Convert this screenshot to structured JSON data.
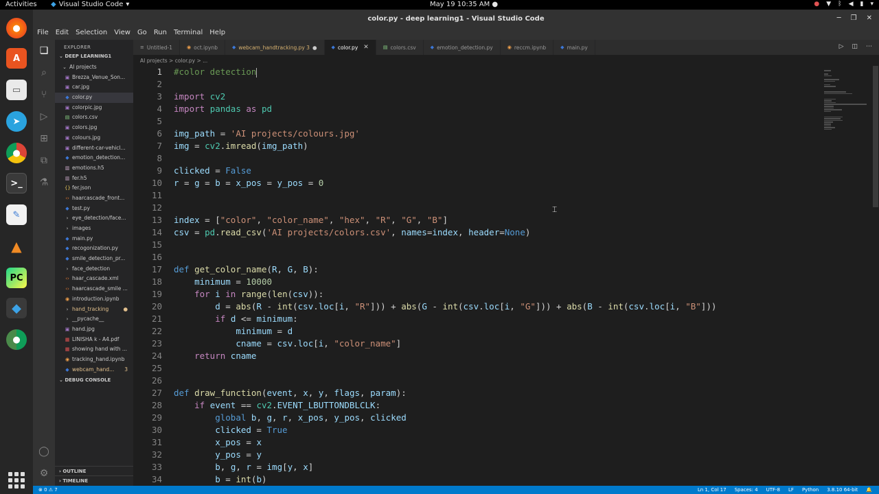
{
  "gnome": {
    "activities": "Activities",
    "app_name": "Visual Studio Code",
    "clock": "May 19  10:35 AM"
  },
  "window": {
    "title": "color.py - deep learning1 - Visual Studio Code"
  },
  "menu": [
    "File",
    "Edit",
    "Selection",
    "View",
    "Go",
    "Run",
    "Terminal",
    "Help"
  ],
  "explorer": {
    "header": "EXPLORER",
    "workspace": "DEEP LEARNING1",
    "folder": "AI projects",
    "files": [
      {
        "name": "Brezza_Venue_Son...",
        "type": "img"
      },
      {
        "name": "car.jpg",
        "type": "img"
      },
      {
        "name": "color.py",
        "type": "py",
        "selected": true
      },
      {
        "name": "colorpic.jpg",
        "type": "img"
      },
      {
        "name": "colors.csv",
        "type": "csv"
      },
      {
        "name": "colors.jpg",
        "type": "img"
      },
      {
        "name": "colours.jpg",
        "type": "img"
      },
      {
        "name": "different-car-vehicl...",
        "type": "img"
      },
      {
        "name": "emotion_detection...",
        "type": "py"
      },
      {
        "name": "emotions.h5",
        "type": "h5"
      },
      {
        "name": "fer.h5",
        "type": "h5"
      },
      {
        "name": "fer.json",
        "type": "json"
      },
      {
        "name": "haarcascade_front...",
        "type": "xml"
      },
      {
        "name": "test.py",
        "type": "py"
      },
      {
        "name": "eye_detection/face...",
        "type": "fold"
      },
      {
        "name": "images",
        "type": "fold"
      },
      {
        "name": "main.py",
        "type": "py"
      },
      {
        "name": "recogonization.py",
        "type": "py"
      },
      {
        "name": "smile_detection_pr...",
        "type": "py"
      },
      {
        "name": "face_detection",
        "type": "fold"
      },
      {
        "name": "haar_cascade.xml",
        "type": "xml"
      },
      {
        "name": "haarcascade_smile ...",
        "type": "xml"
      },
      {
        "name": "introduction.ipynb",
        "type": "nb"
      },
      {
        "name": "hand_tracking",
        "type": "fold",
        "git": true
      },
      {
        "name": "__pycache__",
        "type": "fold"
      },
      {
        "name": "hand.jpg",
        "type": "img"
      },
      {
        "name": "LINISHA k - A4.pdf",
        "type": "pdf"
      },
      {
        "name": "showing hand with ...",
        "type": "pdf"
      },
      {
        "name": "tracking_hand.ipynb",
        "type": "nb"
      },
      {
        "name": "webcam_hand...",
        "type": "py",
        "git": true,
        "badge": "3"
      }
    ],
    "debug_console": "DEBUG CONSOLE",
    "outline": "OUTLINE",
    "timeline": "TIMELINE"
  },
  "tabs": [
    {
      "label": "Untitled-1",
      "icon": "txt"
    },
    {
      "label": "oct.ipynb",
      "icon": "nb"
    },
    {
      "label": "webcam_handtracking.py 3",
      "icon": "py",
      "git": true,
      "dirty": true
    },
    {
      "label": "color.py",
      "icon": "py",
      "active": true
    },
    {
      "label": "colors.csv",
      "icon": "csv"
    },
    {
      "label": "emotion_detection.py",
      "icon": "py"
    },
    {
      "label": "reccm.ipynb",
      "icon": "nb"
    },
    {
      "label": "main.py",
      "icon": "py"
    }
  ],
  "breadcrumb": "AI projects  >  color.py  >  ...",
  "code_lines": [
    [
      [
        "cm",
        "#color detection"
      ]
    ],
    [],
    [
      [
        "kw",
        "import"
      ],
      [
        "op",
        " "
      ],
      [
        "mod",
        "cv2"
      ]
    ],
    [
      [
        "kw",
        "import"
      ],
      [
        "op",
        " "
      ],
      [
        "mod",
        "pandas"
      ],
      [
        "op",
        " "
      ],
      [
        "kw",
        "as"
      ],
      [
        "op",
        " "
      ],
      [
        "mod",
        "pd"
      ]
    ],
    [],
    [
      [
        "var",
        "img_path"
      ],
      [
        "op",
        " = "
      ],
      [
        "str",
        "'AI projects/colours.jpg'"
      ]
    ],
    [
      [
        "var",
        "img"
      ],
      [
        "op",
        " = "
      ],
      [
        "mod",
        "cv2"
      ],
      [
        "op",
        "."
      ],
      [
        "fn",
        "imread"
      ],
      [
        "op",
        "("
      ],
      [
        "var",
        "img_path"
      ],
      [
        "op",
        ")"
      ]
    ],
    [],
    [
      [
        "var",
        "clicked"
      ],
      [
        "op",
        " = "
      ],
      [
        "kd",
        "False"
      ]
    ],
    [
      [
        "var",
        "r"
      ],
      [
        "op",
        " = "
      ],
      [
        "var",
        "g"
      ],
      [
        "op",
        " = "
      ],
      [
        "var",
        "b"
      ],
      [
        "op",
        " = "
      ],
      [
        "var",
        "x_pos"
      ],
      [
        "op",
        " = "
      ],
      [
        "var",
        "y_pos"
      ],
      [
        "op",
        " = "
      ],
      [
        "num",
        "0"
      ]
    ],
    [],
    [],
    [
      [
        "var",
        "index"
      ],
      [
        "op",
        " = ["
      ],
      [
        "str",
        "\"color\""
      ],
      [
        "op",
        ", "
      ],
      [
        "str",
        "\"color_name\""
      ],
      [
        "op",
        ", "
      ],
      [
        "str",
        "\"hex\""
      ],
      [
        "op",
        ", "
      ],
      [
        "str",
        "\"R\""
      ],
      [
        "op",
        ", "
      ],
      [
        "str",
        "\"G\""
      ],
      [
        "op",
        ", "
      ],
      [
        "str",
        "\"B\""
      ],
      [
        "op",
        "]"
      ]
    ],
    [
      [
        "var",
        "csv"
      ],
      [
        "op",
        " = "
      ],
      [
        "mod",
        "pd"
      ],
      [
        "op",
        "."
      ],
      [
        "fn",
        "read_csv"
      ],
      [
        "op",
        "("
      ],
      [
        "str",
        "'AI projects/colors.csv'"
      ],
      [
        "op",
        ", "
      ],
      [
        "var",
        "names"
      ],
      [
        "op",
        "="
      ],
      [
        "var",
        "index"
      ],
      [
        "op",
        ", "
      ],
      [
        "var",
        "header"
      ],
      [
        "op",
        "="
      ],
      [
        "kd",
        "None"
      ],
      [
        "op",
        ")"
      ]
    ],
    [],
    [],
    [
      [
        "kd",
        "def"
      ],
      [
        "op",
        " "
      ],
      [
        "fn",
        "get_color_name"
      ],
      [
        "op",
        "("
      ],
      [
        "var",
        "R"
      ],
      [
        "op",
        ", "
      ],
      [
        "var",
        "G"
      ],
      [
        "op",
        ", "
      ],
      [
        "var",
        "B"
      ],
      [
        "op",
        "):"
      ]
    ],
    [
      [
        "op",
        "    "
      ],
      [
        "var",
        "minimum"
      ],
      [
        "op",
        " = "
      ],
      [
        "num",
        "10000"
      ]
    ],
    [
      [
        "op",
        "    "
      ],
      [
        "kw",
        "for"
      ],
      [
        "op",
        " "
      ],
      [
        "var",
        "i"
      ],
      [
        "op",
        " "
      ],
      [
        "kw",
        "in"
      ],
      [
        "op",
        " "
      ],
      [
        "fn",
        "range"
      ],
      [
        "op",
        "("
      ],
      [
        "fn",
        "len"
      ],
      [
        "op",
        "("
      ],
      [
        "var",
        "csv"
      ],
      [
        "op",
        "))"
      ],
      [
        "op",
        ":"
      ]
    ],
    [
      [
        "op",
        "        "
      ],
      [
        "var",
        "d"
      ],
      [
        "op",
        " = "
      ],
      [
        "fn",
        "abs"
      ],
      [
        "op",
        "("
      ],
      [
        "var",
        "R"
      ],
      [
        "op",
        " - "
      ],
      [
        "fn",
        "int"
      ],
      [
        "op",
        "("
      ],
      [
        "var",
        "csv"
      ],
      [
        "op",
        "."
      ],
      [
        "var",
        "loc"
      ],
      [
        "op",
        "["
      ],
      [
        "var",
        "i"
      ],
      [
        "op",
        ", "
      ],
      [
        "str",
        "\"R\""
      ],
      [
        "op",
        "])) + "
      ],
      [
        "fn",
        "abs"
      ],
      [
        "op",
        "("
      ],
      [
        "var",
        "G"
      ],
      [
        "op",
        " - "
      ],
      [
        "fn",
        "int"
      ],
      [
        "op",
        "("
      ],
      [
        "var",
        "csv"
      ],
      [
        "op",
        "."
      ],
      [
        "var",
        "loc"
      ],
      [
        "op",
        "["
      ],
      [
        "var",
        "i"
      ],
      [
        "op",
        ", "
      ],
      [
        "str",
        "\"G\""
      ],
      [
        "op",
        "])) + "
      ],
      [
        "fn",
        "abs"
      ],
      [
        "op",
        "("
      ],
      [
        "var",
        "B"
      ],
      [
        "op",
        " - "
      ],
      [
        "fn",
        "int"
      ],
      [
        "op",
        "("
      ],
      [
        "var",
        "csv"
      ],
      [
        "op",
        "."
      ],
      [
        "var",
        "loc"
      ],
      [
        "op",
        "["
      ],
      [
        "var",
        "i"
      ],
      [
        "op",
        ", "
      ],
      [
        "str",
        "\"B\""
      ],
      [
        "op",
        "]))"
      ]
    ],
    [
      [
        "op",
        "        "
      ],
      [
        "kw",
        "if"
      ],
      [
        "op",
        " "
      ],
      [
        "var",
        "d"
      ],
      [
        "op",
        " <= "
      ],
      [
        "var",
        "minimum"
      ],
      [
        "op",
        ":"
      ]
    ],
    [
      [
        "op",
        "            "
      ],
      [
        "var",
        "minimum"
      ],
      [
        "op",
        " = "
      ],
      [
        "var",
        "d"
      ]
    ],
    [
      [
        "op",
        "            "
      ],
      [
        "var",
        "cname"
      ],
      [
        "op",
        " = "
      ],
      [
        "var",
        "csv"
      ],
      [
        "op",
        "."
      ],
      [
        "var",
        "loc"
      ],
      [
        "op",
        "["
      ],
      [
        "var",
        "i"
      ],
      [
        "op",
        ", "
      ],
      [
        "str",
        "\"color_name\""
      ],
      [
        "op",
        "]"
      ]
    ],
    [
      [
        "op",
        "    "
      ],
      [
        "kw",
        "return"
      ],
      [
        "op",
        " "
      ],
      [
        "var",
        "cname"
      ]
    ],
    [],
    [],
    [
      [
        "kd",
        "def"
      ],
      [
        "op",
        " "
      ],
      [
        "fn",
        "draw_function"
      ],
      [
        "op",
        "("
      ],
      [
        "var",
        "event"
      ],
      [
        "op",
        ", "
      ],
      [
        "var",
        "x"
      ],
      [
        "op",
        ", "
      ],
      [
        "var",
        "y"
      ],
      [
        "op",
        ", "
      ],
      [
        "var",
        "flags"
      ],
      [
        "op",
        ", "
      ],
      [
        "var",
        "param"
      ],
      [
        "op",
        "):"
      ]
    ],
    [
      [
        "op",
        "    "
      ],
      [
        "kw",
        "if"
      ],
      [
        "op",
        " "
      ],
      [
        "var",
        "event"
      ],
      [
        "op",
        " == "
      ],
      [
        "mod",
        "cv2"
      ],
      [
        "op",
        "."
      ],
      [
        "var",
        "EVENT_LBUTTONDBLCLK"
      ],
      [
        "op",
        ":"
      ]
    ],
    [
      [
        "op",
        "        "
      ],
      [
        "kd",
        "global"
      ],
      [
        "op",
        " "
      ],
      [
        "var",
        "b"
      ],
      [
        "op",
        ", "
      ],
      [
        "var",
        "g"
      ],
      [
        "op",
        ", "
      ],
      [
        "var",
        "r"
      ],
      [
        "op",
        ", "
      ],
      [
        "var",
        "x_pos"
      ],
      [
        "op",
        ", "
      ],
      [
        "var",
        "y_pos"
      ],
      [
        "op",
        ", "
      ],
      [
        "var",
        "clicked"
      ]
    ],
    [
      [
        "op",
        "        "
      ],
      [
        "var",
        "clicked"
      ],
      [
        "op",
        " = "
      ],
      [
        "kd",
        "True"
      ]
    ],
    [
      [
        "op",
        "        "
      ],
      [
        "var",
        "x_pos"
      ],
      [
        "op",
        " = "
      ],
      [
        "var",
        "x"
      ]
    ],
    [
      [
        "op",
        "        "
      ],
      [
        "var",
        "y_pos"
      ],
      [
        "op",
        " = "
      ],
      [
        "var",
        "y"
      ]
    ],
    [
      [
        "op",
        "        "
      ],
      [
        "var",
        "b"
      ],
      [
        "op",
        ", "
      ],
      [
        "var",
        "g"
      ],
      [
        "op",
        ", "
      ],
      [
        "var",
        "r"
      ],
      [
        "op",
        " = "
      ],
      [
        "var",
        "img"
      ],
      [
        "op",
        "["
      ],
      [
        "var",
        "y"
      ],
      [
        "op",
        ", "
      ],
      [
        "var",
        "x"
      ],
      [
        "op",
        "]"
      ]
    ],
    [
      [
        "op",
        "        "
      ],
      [
        "var",
        "b"
      ],
      [
        "op",
        " = "
      ],
      [
        "fn",
        "int"
      ],
      [
        "op",
        "("
      ],
      [
        "var",
        "b"
      ],
      [
        "op",
        ")"
      ]
    ]
  ],
  "status": {
    "left": "⊗ 0 ⚠ 7",
    "position": "Ln 1, Col 17",
    "spaces": "Spaces: 4",
    "encoding": "UTF-8",
    "eol": "LF",
    "language": "Python",
    "interpreter": "3.8.10 64-bit"
  },
  "colors": {
    "statusbar": "#007acc",
    "editor_bg": "#1e1e1e",
    "sidebar_bg": "#252526"
  }
}
